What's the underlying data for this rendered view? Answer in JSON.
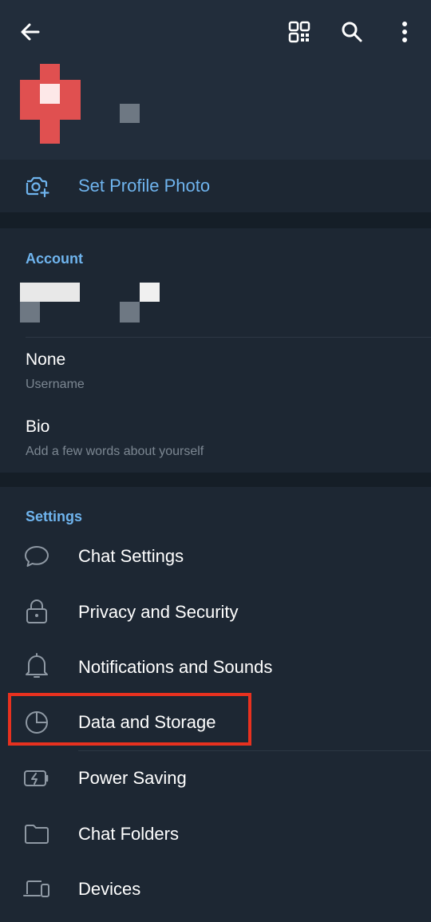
{
  "toolbar": {
    "back_icon": "arrow-left-icon",
    "qr_icon": "qr-code-icon",
    "search_icon": "search-icon",
    "more_icon": "more-vertical-icon"
  },
  "profile": {
    "set_photo_label": "Set Profile Photo"
  },
  "account": {
    "title": "Account",
    "username_value": "None",
    "username_label": "Username",
    "bio_value": "Bio",
    "bio_placeholder": "Add a few words about yourself"
  },
  "settings": {
    "title": "Settings",
    "items": [
      {
        "label": "Chat Settings",
        "icon": "chat-bubble-icon"
      },
      {
        "label": "Privacy and Security",
        "icon": "lock-icon"
      },
      {
        "label": "Notifications and Sounds",
        "icon": "bell-icon"
      },
      {
        "label": "Data and Storage",
        "icon": "pie-chart-icon"
      },
      {
        "label": "Power Saving",
        "icon": "battery-icon"
      },
      {
        "label": "Chat Folders",
        "icon": "folder-icon"
      },
      {
        "label": "Devices",
        "icon": "devices-icon"
      }
    ]
  },
  "colors": {
    "accent": "#6fb4ee",
    "background": "#1d2733",
    "header": "#222d3b",
    "highlight": "#e8311f"
  }
}
